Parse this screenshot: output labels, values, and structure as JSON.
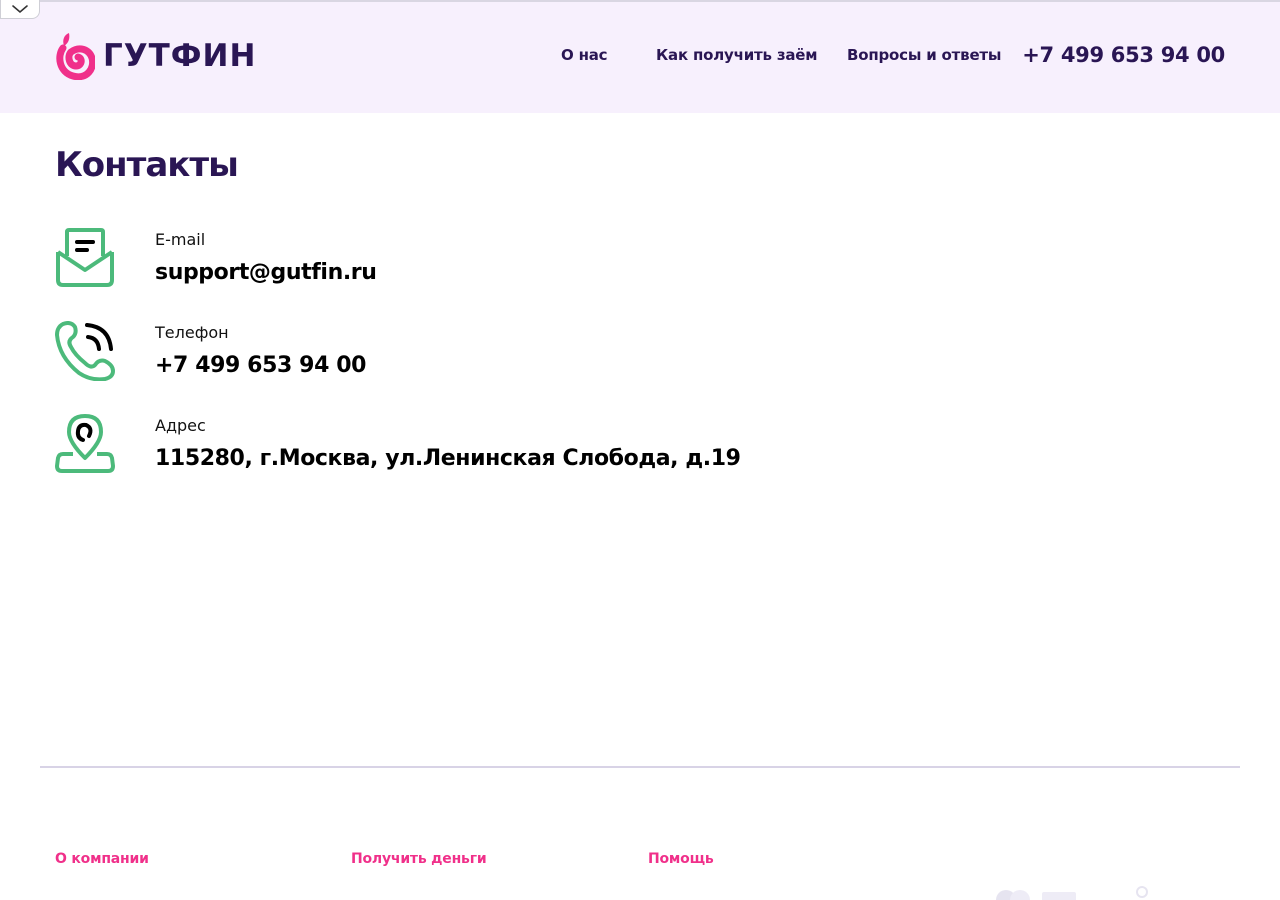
{
  "brand": {
    "name": "ГУТФИН",
    "primary_color": "#2a1654",
    "accent_color": "#f0308a",
    "icon_color": "#4cba7b"
  },
  "header": {
    "nav": [
      {
        "label": "О нас"
      },
      {
        "label": "Как получить заём"
      },
      {
        "label": "Вопросы и ответы"
      }
    ],
    "phone": "+7 499 653 94 00"
  },
  "main": {
    "title": "Контакты",
    "contacts": [
      {
        "icon": "envelope-icon",
        "label": "E-mail",
        "value": "support@gutfin.ru"
      },
      {
        "icon": "phone-icon",
        "label": "Телефон",
        "value": "+7 499 653 94 00"
      },
      {
        "icon": "map-pin-icon",
        "label": "Адрес",
        "value": "115280, г.Москва, ул.Ленинская Слобода, д.19"
      }
    ]
  },
  "footer": {
    "columns": [
      {
        "heading": "О компании"
      },
      {
        "heading": "Получить деньги"
      },
      {
        "heading": "Помощь"
      }
    ]
  }
}
